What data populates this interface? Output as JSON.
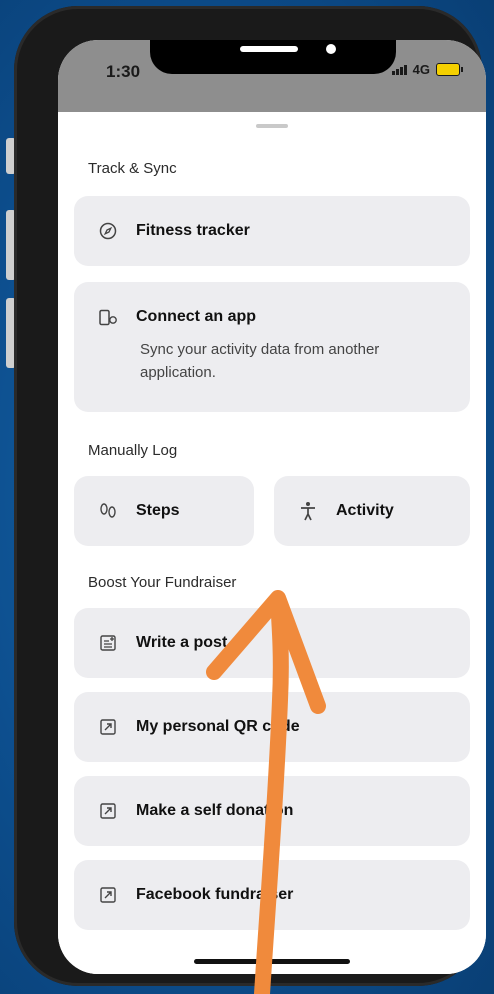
{
  "status_bar": {
    "time": "1:30",
    "network": "4G"
  },
  "sections": {
    "track_sync": "Track & Sync",
    "manually_log": "Manually Log",
    "boost": "Boost Your Fundraiser"
  },
  "items": {
    "fitness_tracker": {
      "label": "Fitness tracker",
      "icon": "compass-icon"
    },
    "connect_app": {
      "label": "Connect an app",
      "description": "Sync your activity data from another application.",
      "icon": "device-sync-icon"
    },
    "steps": {
      "label": "Steps",
      "icon": "footprints-icon"
    },
    "activity": {
      "label": "Activity",
      "icon": "person-icon"
    },
    "write_post": {
      "label": "Write a post",
      "icon": "document-plus-icon"
    },
    "qr_code": {
      "label": "My personal QR code",
      "icon": "external-link-icon"
    },
    "self_donation": {
      "label": "Make a self donation",
      "icon": "external-link-icon"
    },
    "facebook": {
      "label": "Facebook fundraiser",
      "icon": "external-link-icon"
    }
  },
  "colors": {
    "annotation_arrow": "#f08a3c",
    "card_bg": "#ededf0",
    "background": "#0d4f8f"
  }
}
